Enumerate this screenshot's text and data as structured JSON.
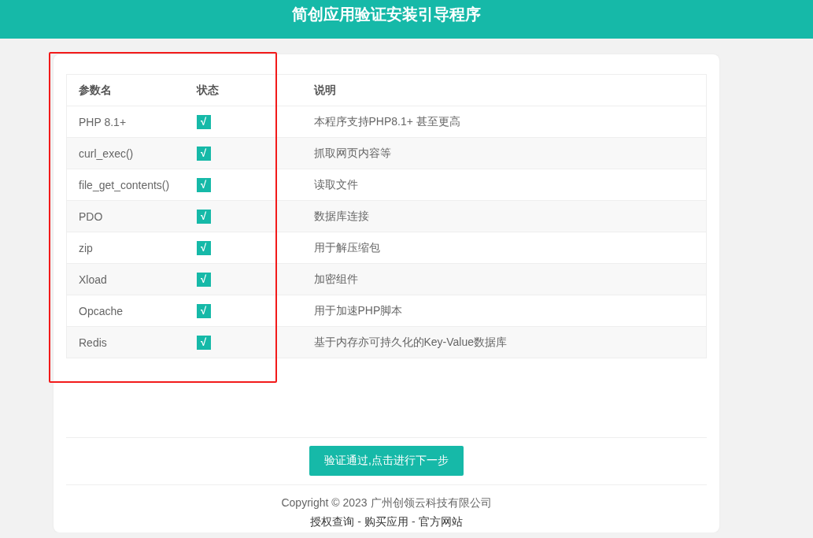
{
  "header": {
    "title": "简创应用验证安装引导程序"
  },
  "table": {
    "columns": [
      "参数名",
      "状态",
      "说明"
    ],
    "rows": [
      {
        "name": "PHP 8.1+",
        "status": "√",
        "passed": true,
        "description": "本程序支持PHP8.1+ 甚至更高"
      },
      {
        "name": "curl_exec()",
        "status": "√",
        "passed": true,
        "description": "抓取网页内容等"
      },
      {
        "name": "file_get_contents()",
        "status": "√",
        "passed": true,
        "description": "读取文件"
      },
      {
        "name": "PDO",
        "status": "√",
        "passed": true,
        "description": "数据库连接"
      },
      {
        "name": "zip",
        "status": "√",
        "passed": true,
        "description": "用于解压缩包"
      },
      {
        "name": "Xload",
        "status": "√",
        "passed": true,
        "description": "加密组件"
      },
      {
        "name": "Opcache",
        "status": "√",
        "passed": true,
        "description": "用于加速PHP脚本"
      },
      {
        "name": "Redis",
        "status": "√",
        "passed": true,
        "description": "基于内存亦可持久化的Key-Value数据库"
      }
    ]
  },
  "next_button": {
    "label": "验证通过,点击进行下一步"
  },
  "footer": {
    "copyright": "Copyright © 2023 广州创领云科技有限公司",
    "links": [
      {
        "kind": "link",
        "label": "授权查询"
      },
      {
        "kind": "separator",
        "label": "-"
      },
      {
        "kind": "link",
        "label": "购买应用"
      },
      {
        "kind": "separator",
        "label": "-"
      },
      {
        "kind": "link",
        "label": "官方网站"
      }
    ]
  }
}
